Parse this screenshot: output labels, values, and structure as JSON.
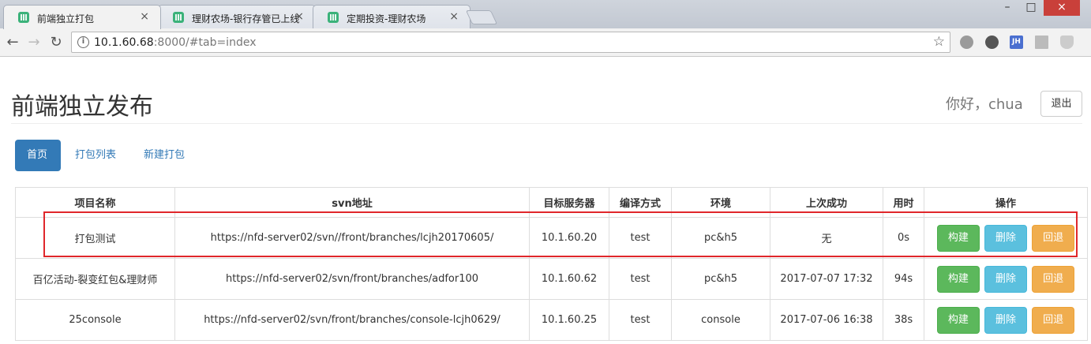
{
  "browser": {
    "tabs": [
      {
        "label": "前端独立打包",
        "close": "×"
      },
      {
        "label": "理财农场-银行存管已上线",
        "close": "×"
      },
      {
        "label": "定期投资-理财农场",
        "close": "×"
      }
    ],
    "window_controls": {
      "minimize": "–",
      "maximize": "□",
      "close": "×"
    },
    "nav": {
      "back": "←",
      "forward": "→",
      "reload": "↻"
    },
    "url_host": "10.1.60.68",
    "url_rest": ":8000/#tab=index",
    "info_icon": "i",
    "star": "☆",
    "extensions": [
      {
        "name": "globe-extension-icon",
        "color": "#9a9a9a"
      },
      {
        "name": "leaf-extension-icon",
        "color": "#555555"
      },
      {
        "name": "jh-extension-icon",
        "color": "#4a6fd0",
        "text": "JH"
      },
      {
        "name": "panel-extension-icon",
        "color": "#bbbbbb"
      },
      {
        "name": "shield-extension-icon",
        "color": "#cccccc"
      }
    ]
  },
  "header": {
    "title": "前端独立发布",
    "greeting": "你好，chua",
    "logout_label": "退出"
  },
  "nav_pills": [
    {
      "label": "首页",
      "active": true
    },
    {
      "label": "打包列表",
      "active": false
    },
    {
      "label": "新建打包",
      "active": false
    }
  ],
  "table": {
    "columns": [
      "项目名称",
      "svn地址",
      "目标服务器",
      "编译方式",
      "环境",
      "上次成功",
      "用时",
      "操作"
    ],
    "rows": [
      [
        "打包测试",
        "https://nfd-server02/svn//front/branches/lcjh20170605/",
        "10.1.60.20",
        "test",
        "pc&h5",
        "无",
        "0s"
      ],
      [
        "百亿活动-裂变红包&理财师",
        "https://nfd-server02/svn/front/branches/adfor100",
        "10.1.60.62",
        "test",
        "pc&h5",
        "2017-07-07 17:32",
        "94s"
      ],
      [
        "25console",
        "https://nfd-server02/svn/front/branches/console-lcjh0629/",
        "10.1.60.25",
        "test",
        "console",
        "2017-07-06 16:38",
        "38s"
      ]
    ],
    "actions": {
      "build": "构建",
      "delete": "删除",
      "rollback": "回退"
    }
  },
  "colors": {
    "primary": "#337ab7",
    "success": "#5cb85c",
    "info": "#5bc0de",
    "warning": "#f0ad4e",
    "highlight": "#e0272b"
  }
}
